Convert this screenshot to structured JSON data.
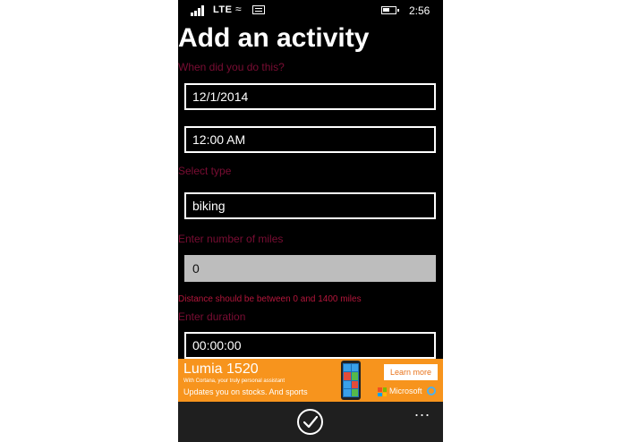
{
  "status_bar": {
    "network": "LTE",
    "time": "2:56",
    "signal_bars": 4,
    "battery_level": 0.55,
    "icons": [
      "signal-icon",
      "wifi-calling-icon",
      "message-icon",
      "battery-icon"
    ]
  },
  "page": {
    "title": "Add an activity"
  },
  "form": {
    "when_label": "When did you do this?",
    "date_value": "12/1/2014",
    "time_value": "12:00 AM",
    "type_label": "Select type",
    "type_value": "biking",
    "miles_label": "Enter number of miles",
    "miles_value": "0",
    "miles_hint": "Distance should be between 0 and 1400 miles",
    "duration_label": "Enter duration",
    "duration_value": "00:00:00"
  },
  "ad": {
    "title": "Lumia 1520",
    "subtitle": "With Cortana, your truly personal assistant",
    "line2": "Updates you on stocks. And sports",
    "button": "Learn more",
    "brand": "Microsoft",
    "background": "#f7941d"
  },
  "app_bar": {
    "accept_icon": "check-circle-icon",
    "more": "..."
  },
  "colors": {
    "label": "#7a0d33",
    "hint": "#b3163b",
    "appbar": "#1f1f1f"
  }
}
